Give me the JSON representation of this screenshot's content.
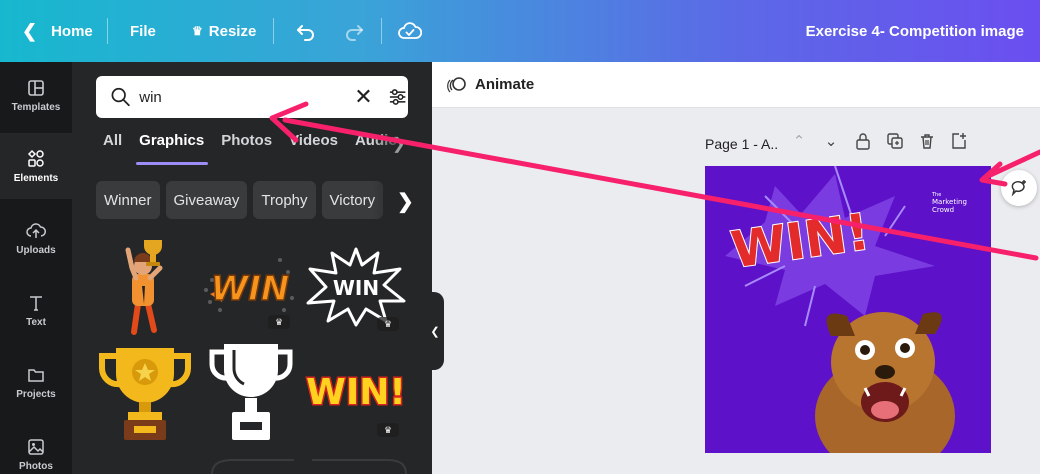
{
  "topbar": {
    "home_label": "Home",
    "file_label": "File",
    "resize_label": "Resize",
    "doc_title": "Exercise 4- Competition image"
  },
  "rail": {
    "items": [
      {
        "label": "Templates",
        "icon": "templates-icon"
      },
      {
        "label": "Elements",
        "icon": "elements-icon"
      },
      {
        "label": "Uploads",
        "icon": "uploads-icon"
      },
      {
        "label": "Text",
        "icon": "text-icon"
      },
      {
        "label": "Projects",
        "icon": "projects-icon"
      },
      {
        "label": "Photos",
        "icon": "photos-icon"
      }
    ]
  },
  "search": {
    "value": "win"
  },
  "tabs": [
    "All",
    "Graphics",
    "Photos",
    "Videos",
    "Audio"
  ],
  "chips": [
    "Winner",
    "Giveaway",
    "Trophy",
    "Victory"
  ],
  "graphics": {
    "win_sticker_text": "WIN",
    "win_star_text": "WIN",
    "win_exclaim_text": "WIN!"
  },
  "canvas_toolbar": {
    "animate_label": "Animate"
  },
  "page": {
    "label": "Page 1 - A.."
  },
  "design": {
    "headline": "WIN!",
    "logo_lines": [
      "The",
      "Marketing",
      "Crowd"
    ]
  },
  "colors": {
    "annotation_arrow": "#f7216b",
    "design_bg": "#5d11c9",
    "tab_underline": "#9c8cf5"
  }
}
